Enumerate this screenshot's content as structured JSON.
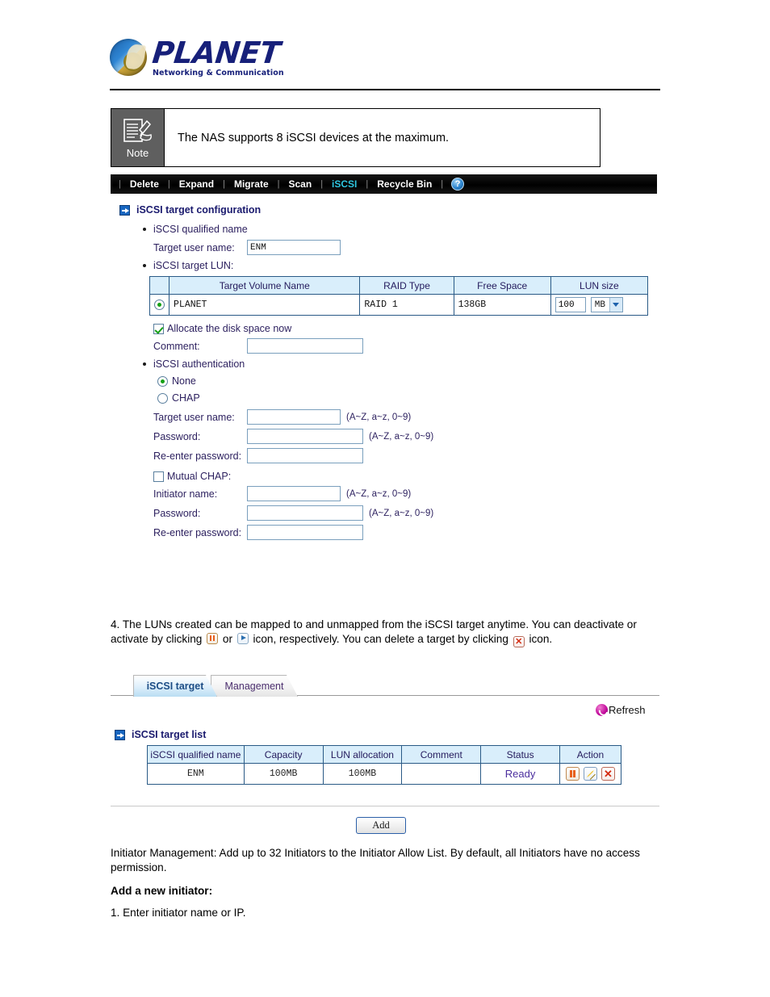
{
  "brand": {
    "name": "PLANET",
    "tagline": "Networking & Communication"
  },
  "note": {
    "label": "Note",
    "text": "The NAS supports 8 iSCSI devices at the maximum."
  },
  "toolbar": {
    "items": [
      {
        "label": "Delete",
        "active": false
      },
      {
        "label": "Expand",
        "active": false
      },
      {
        "label": "Migrate",
        "active": false
      },
      {
        "label": "Scan",
        "active": false
      },
      {
        "label": "iSCSI",
        "active": true
      },
      {
        "label": "Recycle Bin",
        "active": false
      }
    ],
    "help_glyph": "?",
    "active_color": "#2fc6e0"
  },
  "config": {
    "section_title": "iSCSI target configuration",
    "qualified_name_label": "iSCSI qualified name",
    "target_user_name_label": "Target user name:",
    "target_user_name_value": "ENM",
    "target_lun_label": "iSCSI target LUN:",
    "lun_table": {
      "headers": [
        "",
        "Target Volume Name",
        "RAID Type",
        "Free Space",
        "LUN size"
      ],
      "rows": [
        {
          "selected": true,
          "volume_name": "PLANET",
          "raid_type": "RAID 1",
          "free_space": "138GB",
          "lun_size_value": "100",
          "lun_size_unit": "MB"
        }
      ]
    },
    "allocate_label": "Allocate the disk space now",
    "allocate_checked": true,
    "comment_label": "Comment:",
    "comment_value": "",
    "auth_label": "iSCSI authentication",
    "auth_options": [
      {
        "label": "None",
        "selected": true
      },
      {
        "label": "CHAP",
        "selected": false
      }
    ],
    "chap_fields": [
      {
        "label": "Target user name:",
        "value": "",
        "hint": "(A~Z, a~z, 0~9)"
      },
      {
        "label": "Password:",
        "value": "",
        "hint": "(A~Z, a~z, 0~9)"
      },
      {
        "label": "Re-enter password:",
        "value": "",
        "hint": ""
      }
    ],
    "mutual_chap_label": "Mutual CHAP:",
    "mutual_chap_checked": false,
    "mutual_fields": [
      {
        "label": "Initiator name:",
        "value": "",
        "hint": "(A~Z, a~z, 0~9)"
      },
      {
        "label": "Password:",
        "value": "",
        "hint": "(A~Z, a~z, 0~9)"
      },
      {
        "label": "Re-enter password:",
        "value": "",
        "hint": ""
      }
    ]
  },
  "paragraph4": {
    "part1": "4. The LUNs created can be mapped to and unmapped from the iSCSI target anytime. You can deactivate or activate by clicking ",
    "part2": " or ",
    "part3": " icon, respectively. You can delete a target by clicking ",
    "part4": " icon."
  },
  "tabs": [
    {
      "label": "iSCSI target",
      "active": true
    },
    {
      "label": "Management",
      "active": false
    }
  ],
  "refresh": {
    "label": "Refresh"
  },
  "target_list": {
    "section_title": "iSCSI target list",
    "headers": [
      "iSCSI qualified name",
      "Capacity",
      "LUN allocation",
      "Comment",
      "Status",
      "Action"
    ],
    "rows": [
      {
        "qualified_name": "ENM",
        "capacity": "100MB",
        "lun_allocation": "100MB",
        "comment": "",
        "status": "Ready",
        "status_color": "#4b2e9e"
      }
    ]
  },
  "add_button": {
    "label": "Add"
  },
  "footer": {
    "initiator_text": "Initiator Management: Add up to 32 Initiators to the Initiator Allow List. By default, all Initiators have no access permission.",
    "add_heading": "Add a new initiator:",
    "step1": "1. Enter initiator name or IP."
  }
}
